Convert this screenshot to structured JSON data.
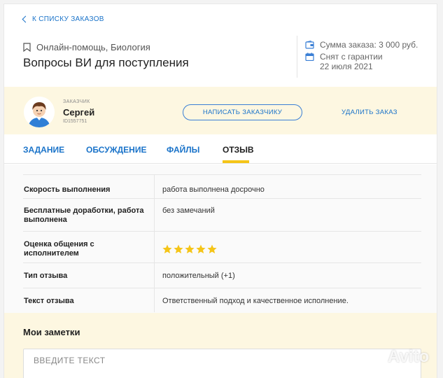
{
  "header": {
    "back_label": "К СПИСКУ ЗАКАЗОВ",
    "category": "Онлайн-помощь, Биология",
    "title": "Вопросы ВИ для поступления",
    "sum_text": "Сумма заказа: 3 000 руб.",
    "status_line1": "Снят с гарантии",
    "status_line2": "22 июля 2021"
  },
  "customer": {
    "caption": "ЗАКАЗЧИК",
    "name": "Сергей",
    "id": "ID1557751",
    "write_button": "НАПИСАТЬ ЗАКАЗЧИКУ",
    "delete_button": "УДАЛИТЬ ЗАКАЗ"
  },
  "tabs": [
    {
      "label": "ЗАДАНИЕ",
      "active": false
    },
    {
      "label": "ОБСУЖДЕНИЕ",
      "active": false
    },
    {
      "label": "ФАЙЛЫ",
      "active": false
    },
    {
      "label": "ОТЗЫВ",
      "active": true
    }
  ],
  "review": {
    "rows": [
      {
        "label": "Скорость выполнения",
        "value": "работа выполнена досрочно"
      },
      {
        "label": "Бесплатные доработки, работа выполнена",
        "value": "без замечаний"
      },
      {
        "label": "Оценка общения с исполнителем",
        "rating": 5,
        "rating_max": 5
      },
      {
        "label": "Тип отзыва",
        "value": "положительный (+1)"
      },
      {
        "label": "Текст отзыва",
        "value": "Ответственный подход и качественное исполнение."
      }
    ]
  },
  "notes": {
    "title": "Мои заметки",
    "placeholder": "ВВЕДИТЕ ТЕКСТ",
    "value": ""
  },
  "watermark": "Avito",
  "colors": {
    "accent": "#1a73c9",
    "highlight_bg": "#fdf7e1",
    "tab_underline": "#f5c518",
    "star": "#f5c518"
  }
}
